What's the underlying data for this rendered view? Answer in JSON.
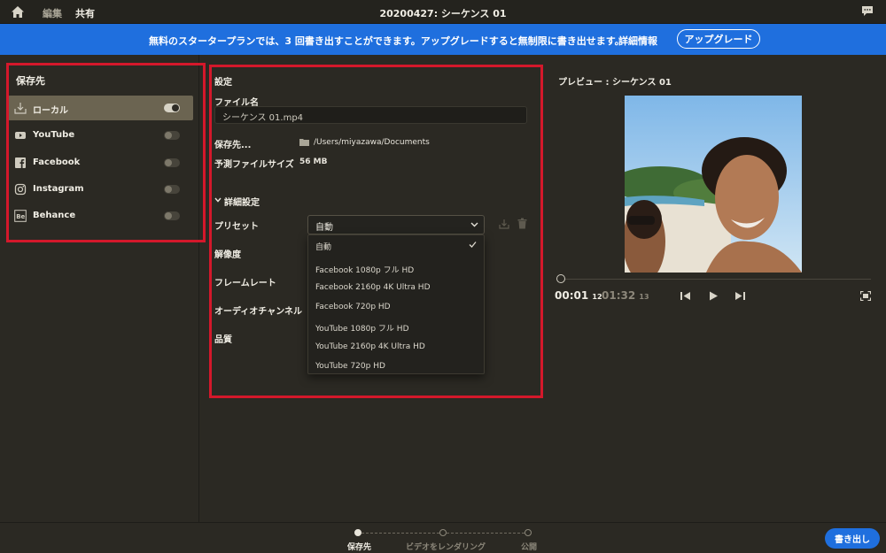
{
  "topbar": {
    "tabs": [
      "編集",
      "共有"
    ],
    "active_tab": "共有",
    "title": "20200427: シーケンス 01"
  },
  "banner": {
    "message": "無料のスタータープランでは、3 回書き出すことができます。アップグレードすると無制限に書き出せます。",
    "details_label": "詳細情報",
    "upgrade_label": "アップグレード",
    "color": "#1f6fde"
  },
  "destinations": {
    "title": "保存先",
    "items": [
      {
        "label": "ローカル",
        "icon": "download-icon",
        "enabled": true
      },
      {
        "label": "YouTube",
        "icon": "youtube-icon",
        "enabled": false
      },
      {
        "label": "Facebook",
        "icon": "facebook-icon",
        "enabled": false
      },
      {
        "label": "Instagram",
        "icon": "instagram-icon",
        "enabled": false
      },
      {
        "label": "Behance",
        "icon": "behance-icon",
        "enabled": false
      }
    ]
  },
  "settings": {
    "title": "設定",
    "filename_label": "ファイル名",
    "filename_value": "シーケンス 01.mp4",
    "save_to_label": "保存先...",
    "save_to_path": "/Users/miyazawa/Documents",
    "est_size_label": "予測ファイルサイズ",
    "est_size_value": "56 MB",
    "advanced_label": "詳細設定",
    "preset_label": "プリセット",
    "preset_value": "自動",
    "resolution_label": "解像度",
    "framerate_label": "フレームレート",
    "audio_label": "オーディオチャンネル",
    "quality_label": "品質",
    "preset_options": [
      "自動",
      "Facebook 1080p フル HD",
      "Facebook 2160p 4K Ultra HD",
      "Facebook 720p HD",
      "YouTube 1080p フル HD",
      "YouTube 2160p 4K Ultra HD",
      "YouTube 720p HD"
    ]
  },
  "preview": {
    "title": "プレビュー : シーケンス 01",
    "current_time": "00:01",
    "current_frames": "12",
    "total_time": "01:32",
    "total_frames": "13",
    "playhead_fraction": 0.0
  },
  "steps": {
    "items": [
      "保存先",
      "ビデオをレンダリング",
      "公開"
    ],
    "active_index": 0
  },
  "export_label": "書き出し",
  "accent_color": "#1f6fde",
  "annotation_color": "#d4182b"
}
